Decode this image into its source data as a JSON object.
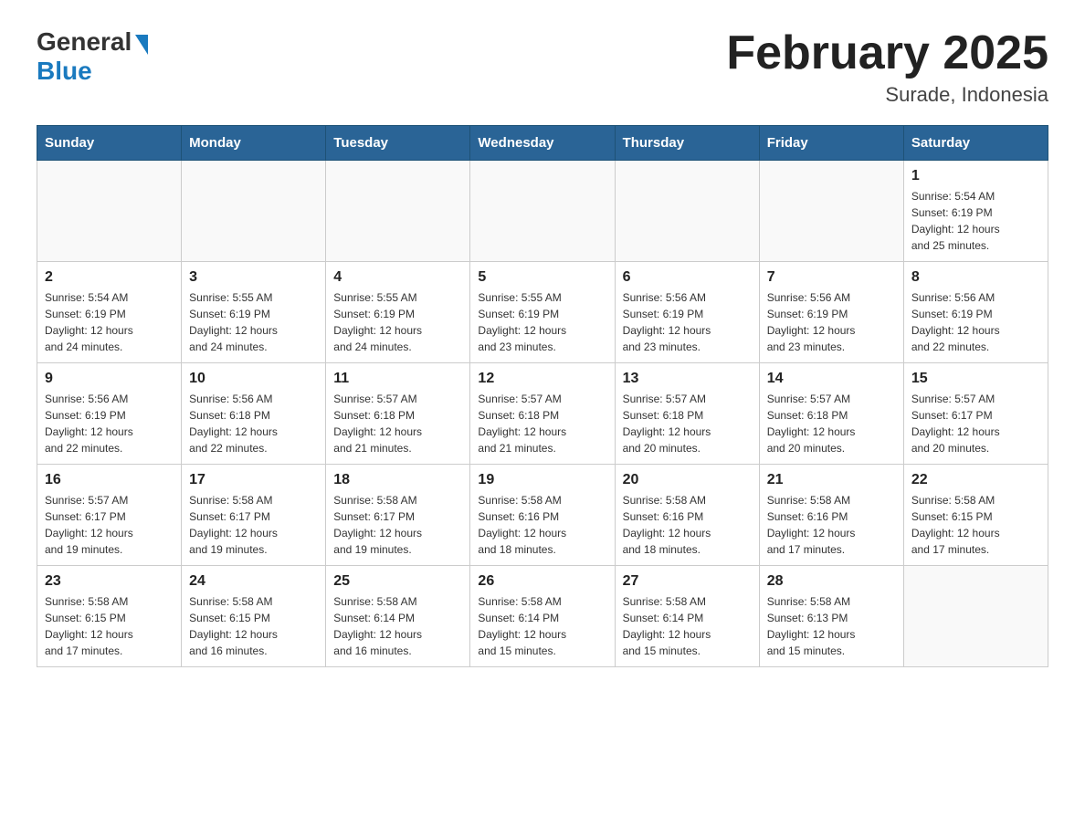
{
  "logo": {
    "general": "General",
    "blue": "Blue"
  },
  "title": "February 2025",
  "subtitle": "Surade, Indonesia",
  "days_of_week": [
    "Sunday",
    "Monday",
    "Tuesday",
    "Wednesday",
    "Thursday",
    "Friday",
    "Saturday"
  ],
  "weeks": [
    [
      {
        "day": "",
        "info": ""
      },
      {
        "day": "",
        "info": ""
      },
      {
        "day": "",
        "info": ""
      },
      {
        "day": "",
        "info": ""
      },
      {
        "day": "",
        "info": ""
      },
      {
        "day": "",
        "info": ""
      },
      {
        "day": "1",
        "info": "Sunrise: 5:54 AM\nSunset: 6:19 PM\nDaylight: 12 hours\nand 25 minutes."
      }
    ],
    [
      {
        "day": "2",
        "info": "Sunrise: 5:54 AM\nSunset: 6:19 PM\nDaylight: 12 hours\nand 24 minutes."
      },
      {
        "day": "3",
        "info": "Sunrise: 5:55 AM\nSunset: 6:19 PM\nDaylight: 12 hours\nand 24 minutes."
      },
      {
        "day": "4",
        "info": "Sunrise: 5:55 AM\nSunset: 6:19 PM\nDaylight: 12 hours\nand 24 minutes."
      },
      {
        "day": "5",
        "info": "Sunrise: 5:55 AM\nSunset: 6:19 PM\nDaylight: 12 hours\nand 23 minutes."
      },
      {
        "day": "6",
        "info": "Sunrise: 5:56 AM\nSunset: 6:19 PM\nDaylight: 12 hours\nand 23 minutes."
      },
      {
        "day": "7",
        "info": "Sunrise: 5:56 AM\nSunset: 6:19 PM\nDaylight: 12 hours\nand 23 minutes."
      },
      {
        "day": "8",
        "info": "Sunrise: 5:56 AM\nSunset: 6:19 PM\nDaylight: 12 hours\nand 22 minutes."
      }
    ],
    [
      {
        "day": "9",
        "info": "Sunrise: 5:56 AM\nSunset: 6:19 PM\nDaylight: 12 hours\nand 22 minutes."
      },
      {
        "day": "10",
        "info": "Sunrise: 5:56 AM\nSunset: 6:18 PM\nDaylight: 12 hours\nand 22 minutes."
      },
      {
        "day": "11",
        "info": "Sunrise: 5:57 AM\nSunset: 6:18 PM\nDaylight: 12 hours\nand 21 minutes."
      },
      {
        "day": "12",
        "info": "Sunrise: 5:57 AM\nSunset: 6:18 PM\nDaylight: 12 hours\nand 21 minutes."
      },
      {
        "day": "13",
        "info": "Sunrise: 5:57 AM\nSunset: 6:18 PM\nDaylight: 12 hours\nand 20 minutes."
      },
      {
        "day": "14",
        "info": "Sunrise: 5:57 AM\nSunset: 6:18 PM\nDaylight: 12 hours\nand 20 minutes."
      },
      {
        "day": "15",
        "info": "Sunrise: 5:57 AM\nSunset: 6:17 PM\nDaylight: 12 hours\nand 20 minutes."
      }
    ],
    [
      {
        "day": "16",
        "info": "Sunrise: 5:57 AM\nSunset: 6:17 PM\nDaylight: 12 hours\nand 19 minutes."
      },
      {
        "day": "17",
        "info": "Sunrise: 5:58 AM\nSunset: 6:17 PM\nDaylight: 12 hours\nand 19 minutes."
      },
      {
        "day": "18",
        "info": "Sunrise: 5:58 AM\nSunset: 6:17 PM\nDaylight: 12 hours\nand 19 minutes."
      },
      {
        "day": "19",
        "info": "Sunrise: 5:58 AM\nSunset: 6:16 PM\nDaylight: 12 hours\nand 18 minutes."
      },
      {
        "day": "20",
        "info": "Sunrise: 5:58 AM\nSunset: 6:16 PM\nDaylight: 12 hours\nand 18 minutes."
      },
      {
        "day": "21",
        "info": "Sunrise: 5:58 AM\nSunset: 6:16 PM\nDaylight: 12 hours\nand 17 minutes."
      },
      {
        "day": "22",
        "info": "Sunrise: 5:58 AM\nSunset: 6:15 PM\nDaylight: 12 hours\nand 17 minutes."
      }
    ],
    [
      {
        "day": "23",
        "info": "Sunrise: 5:58 AM\nSunset: 6:15 PM\nDaylight: 12 hours\nand 17 minutes."
      },
      {
        "day": "24",
        "info": "Sunrise: 5:58 AM\nSunset: 6:15 PM\nDaylight: 12 hours\nand 16 minutes."
      },
      {
        "day": "25",
        "info": "Sunrise: 5:58 AM\nSunset: 6:14 PM\nDaylight: 12 hours\nand 16 minutes."
      },
      {
        "day": "26",
        "info": "Sunrise: 5:58 AM\nSunset: 6:14 PM\nDaylight: 12 hours\nand 15 minutes."
      },
      {
        "day": "27",
        "info": "Sunrise: 5:58 AM\nSunset: 6:14 PM\nDaylight: 12 hours\nand 15 minutes."
      },
      {
        "day": "28",
        "info": "Sunrise: 5:58 AM\nSunset: 6:13 PM\nDaylight: 12 hours\nand 15 minutes."
      },
      {
        "day": "",
        "info": ""
      }
    ]
  ]
}
